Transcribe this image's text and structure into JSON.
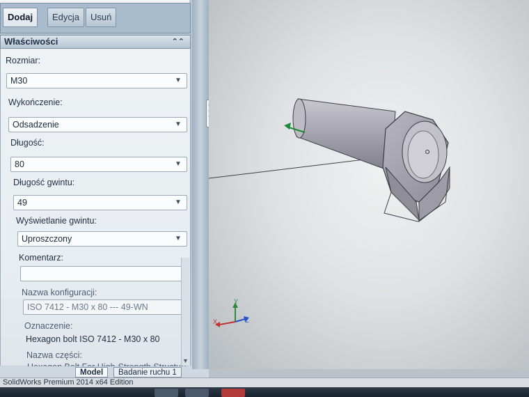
{
  "toolbar": {
    "add_label": "Dodaj",
    "edit_label": "Edycja",
    "delete_label": "Usuń"
  },
  "properties": {
    "header": "Właściwości",
    "size_label": "Rozmiar:",
    "size_value": "M30",
    "finish_label": "Wykończenie:",
    "finish_value": "Odsadzenie",
    "length_label": "Długość:",
    "length_value": "80",
    "thread_length_label": "Długość gwintu:",
    "thread_length_value": "49",
    "thread_display_label": "Wyświetlanie gwintu:",
    "thread_display_value": "Uproszczony",
    "comment_label": "Komentarz:",
    "comment_value": "",
    "config_name_label": "Nazwa konfiguracji:",
    "config_name_value": "ISO 7412 - M30 x 80 --- 49-WN",
    "designation_label": "Oznaczenie:",
    "designation_value": "Hexagon bolt ISO 7412 - M30 x 80",
    "part_name_label": "Nazwa części:",
    "part_name_value": "Hexagon Bolt For High-Strength Structural"
  },
  "bottom_tabs": [
    "Model",
    "Badanie ruchu 1"
  ],
  "status": {
    "text": "SolidWorks Premium 2014 x64 Edition"
  },
  "triad": {
    "x": "X",
    "y": "Y",
    "z": "Z"
  },
  "colors": {
    "panel": "#aebfce",
    "viewport": "#e6e8e9",
    "bolt": "#a9a9b3"
  }
}
